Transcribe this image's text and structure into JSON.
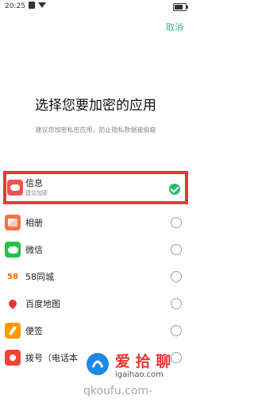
{
  "status_bar": {
    "time": "20:25"
  },
  "header": {
    "cancel_label": "取消"
  },
  "title": "选择您要加密的应用",
  "subtitle": "建议您加密私密应用，防止隐私数据被偷窥",
  "apps": [
    {
      "name": "信息",
      "sub": "建议加密",
      "checked": true,
      "icon": "message-icon"
    },
    {
      "name": "相册",
      "checked": false,
      "icon": "photos-icon"
    },
    {
      "name": "微信",
      "checked": false,
      "icon": "wechat-icon"
    },
    {
      "name": "58同城",
      "checked": false,
      "icon": "58-icon"
    },
    {
      "name": "百度地图",
      "checked": false,
      "icon": "baidu-map-icon"
    },
    {
      "name": "便签",
      "checked": false,
      "icon": "notes-icon"
    },
    {
      "name": "拨号（电话本",
      "checked": false,
      "icon": "dialer-icon"
    }
  ],
  "watermark": {
    "brand": "爱 拾 聊",
    "url": "igaihao.com",
    "bottom": "qkoufu.com-"
  },
  "colors": {
    "accent": "#2fb673",
    "highlight": "#e53935"
  }
}
